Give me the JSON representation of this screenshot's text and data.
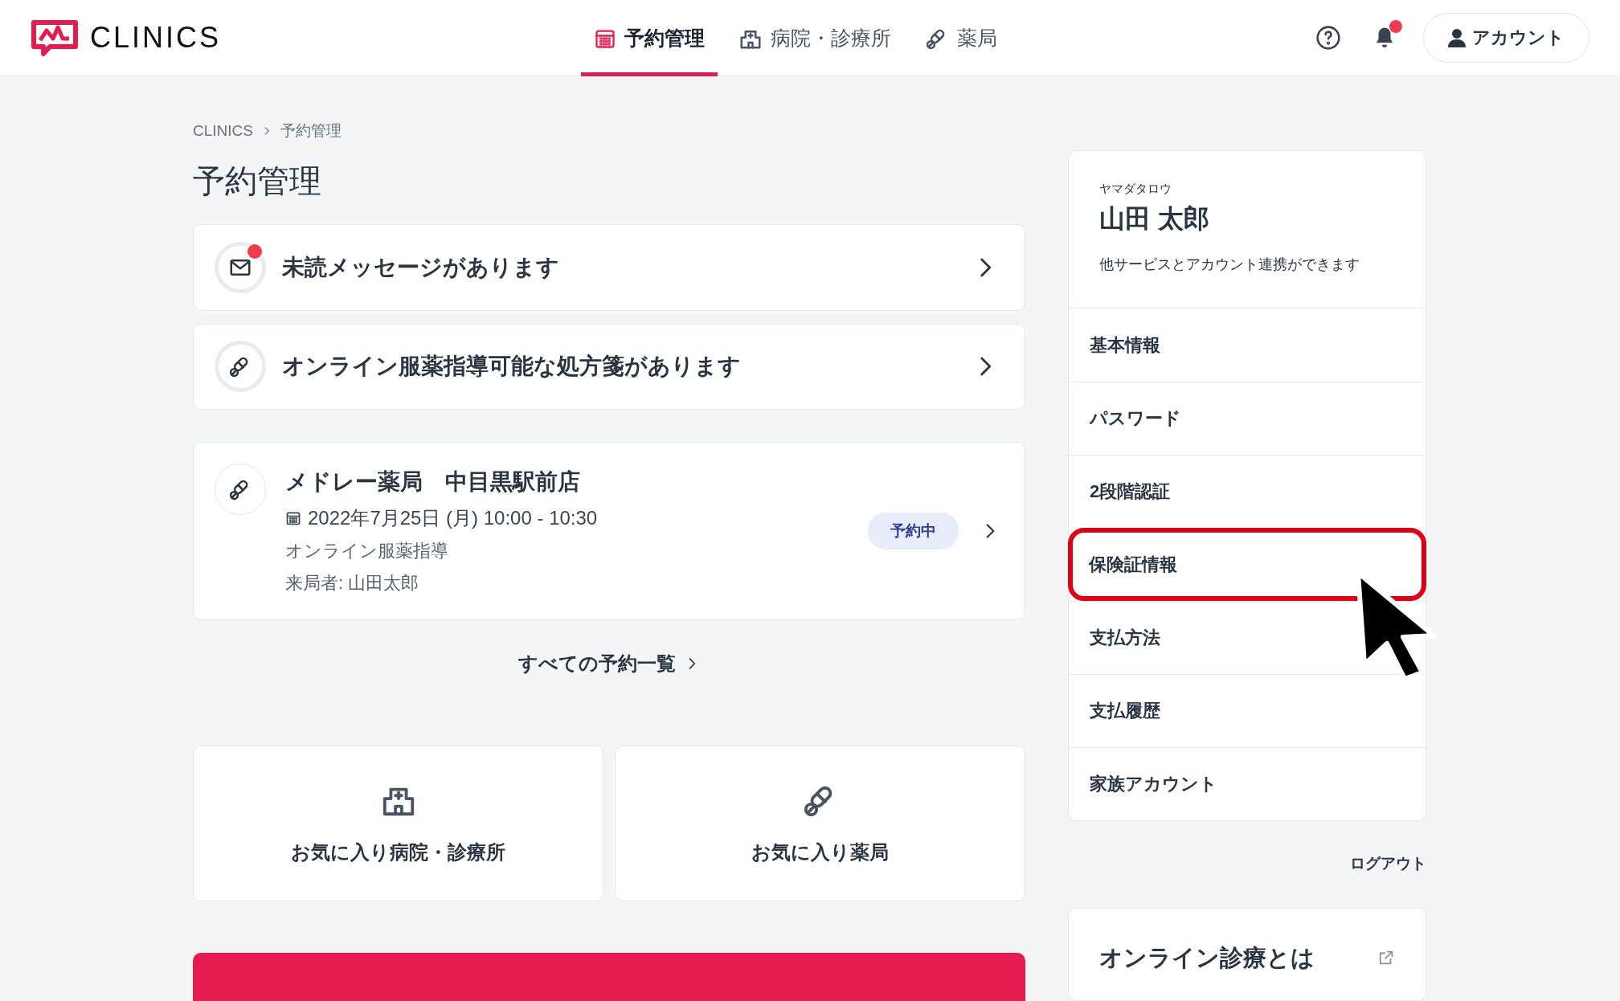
{
  "header": {
    "logo": "CLINICS",
    "tabs": [
      {
        "label": "予約管理",
        "kind": "calendar",
        "selected": true
      },
      {
        "label": "病院・診療所",
        "kind": "hospital",
        "selected": false
      },
      {
        "label": "薬局",
        "kind": "pill",
        "selected": false
      }
    ],
    "notifications_unread": true,
    "account_button": "アカウント"
  },
  "breadcrumb": [
    "CLINICS",
    "予約管理"
  ],
  "page_title": "予約管理",
  "notices": [
    {
      "kind": "mail",
      "unread": true,
      "text": "未読メッセージがあります"
    },
    {
      "kind": "pill",
      "unread": false,
      "text": "オンライン服薬指導可能な処方箋があります"
    }
  ],
  "appointment": {
    "name": "メドレー薬局　中目黒駅前店",
    "datetime": "2022年7月25日 (月) 10:00 - 10:30",
    "type": "オンライン服薬指導",
    "visitor": "来局者: 山田太郎",
    "status": "予約中"
  },
  "all_link": "すべての予約一覧",
  "favorites": [
    {
      "kind": "hospital",
      "label": "お気に入り病院・診療所"
    },
    {
      "kind": "pill",
      "label": "お気に入り薬局"
    }
  ],
  "profile": {
    "kana": "ヤマダタロウ",
    "name": "山田 太郎",
    "note": "他サービスとアカウント連携ができます"
  },
  "menu": [
    {
      "label": "基本情報",
      "highlighted": false
    },
    {
      "label": "パスワード",
      "highlighted": false
    },
    {
      "label": "2段階認証",
      "highlighted": false
    },
    {
      "label": "保険証情報",
      "highlighted": true
    },
    {
      "label": "支払方法",
      "highlighted": false
    },
    {
      "label": "支払履歴",
      "highlighted": false
    },
    {
      "label": "家族アカウント",
      "highlighted": false
    }
  ],
  "logout": "ログアウト",
  "info_card": {
    "title": "オンライン診療とは"
  }
}
